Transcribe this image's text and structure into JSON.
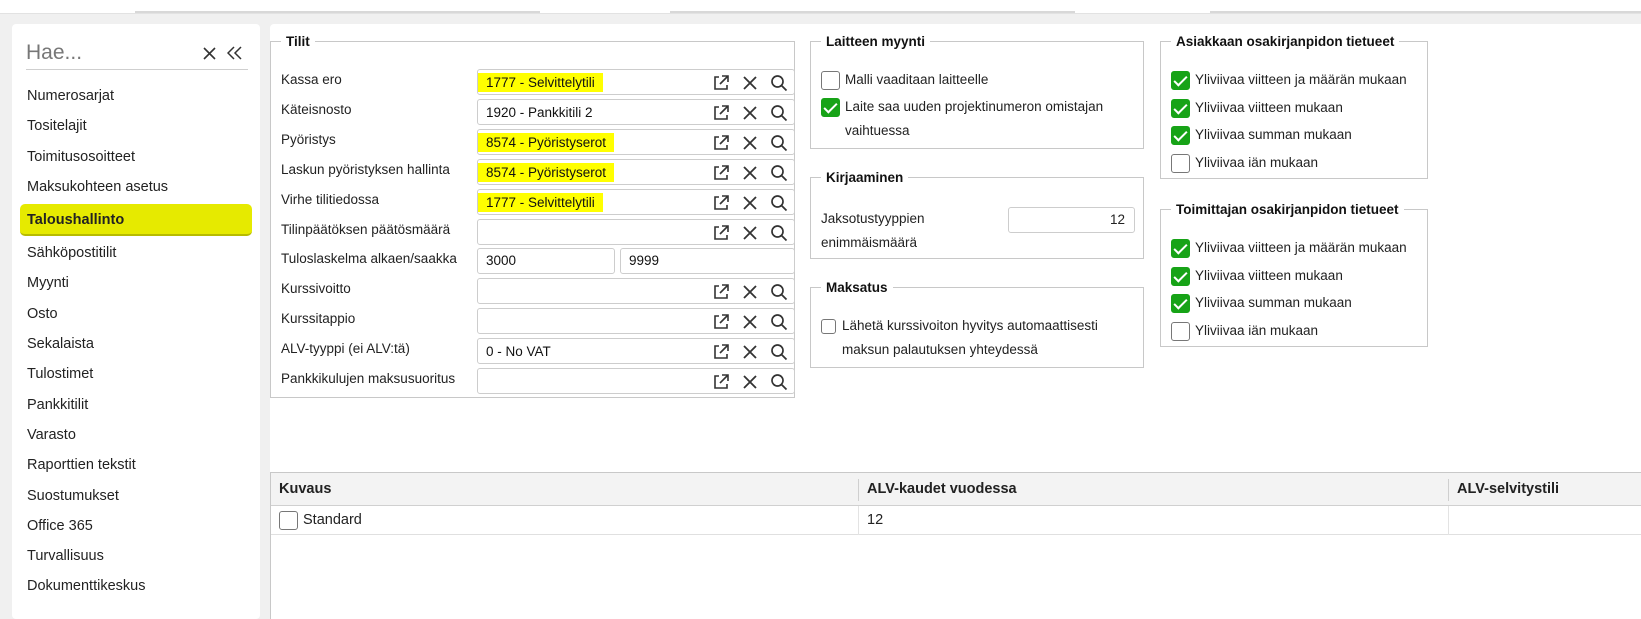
{
  "sidebar": {
    "search_placeholder": "Hae...",
    "items": [
      {
        "label": "Numerosarjat"
      },
      {
        "label": "Tositelajit"
      },
      {
        "label": "Toimitusosoitteet"
      },
      {
        "label": "Maksukohteen asetus"
      },
      {
        "label": "Taloushallinto",
        "active": true
      },
      {
        "label": "Sähköpostitilit"
      },
      {
        "label": "Myynti"
      },
      {
        "label": "Osto"
      },
      {
        "label": "Sekalaista"
      },
      {
        "label": "Tulostimet"
      },
      {
        "label": "Pankkitilit"
      },
      {
        "label": "Varasto"
      },
      {
        "label": "Raporttien tekstit"
      },
      {
        "label": "Suostumukset"
      },
      {
        "label": "Office 365"
      },
      {
        "label": "Turvallisuus"
      },
      {
        "label": "Dokumenttikeskus"
      }
    ]
  },
  "tilit": {
    "title": "Tilit",
    "rows": [
      {
        "label": "Kassa ero",
        "value": "1777 - Selvittelytili",
        "highlighted": true
      },
      {
        "label": "Käteisnosto",
        "value": "1920 - Pankkitili 2",
        "highlighted": false
      },
      {
        "label": "Pyöristys",
        "value": "8574 - Pyöristyserot",
        "highlighted": true
      },
      {
        "label": "Laskun pyöristyksen hallinta",
        "value": "8574 - Pyöristyserot",
        "highlighted": true
      },
      {
        "label": "Virhe tilitiedossa",
        "value": "1777 - Selvittelytili",
        "highlighted": true
      },
      {
        "label": "Tilinpäätöksen päätösmäärä",
        "value": "",
        "highlighted": false
      },
      {
        "label": "Tuloslaskelma alkaen/saakka",
        "from": "3000",
        "to": "9999",
        "range": true
      },
      {
        "label": "Kurssivoitto",
        "value": "",
        "highlighted": false
      },
      {
        "label": "Kurssitappio",
        "value": "",
        "highlighted": false
      },
      {
        "label": "ALV-tyyppi (ei ALV:tä)",
        "value": "0 - No VAT",
        "highlighted": false
      },
      {
        "label": "Pankkikulujen maksusuoritus",
        "value": "",
        "highlighted": false
      }
    ]
  },
  "laitteen_myynti": {
    "title": "Laitteen myynti",
    "opt1": {
      "label": "Malli vaaditaan laitteelle",
      "checked": false
    },
    "opt2": {
      "line1": "Laite saa uuden projektinumeron omistajan",
      "line2": "vaihtuessa",
      "checked": true
    }
  },
  "kirjaaminen": {
    "title": "Kirjaaminen",
    "label1": "Jaksotustyyppien",
    "label2": "enimmäismäärä",
    "value": "12"
  },
  "maksatus": {
    "title": "Maksatus",
    "line1": "Lähetä kurssivoiton hyvitys automaattisesti",
    "line2": "maksun palautuksen yhteydessä",
    "checked": false
  },
  "asiakas": {
    "title": "Asiakkaan osakirjanpidon tietueet",
    "items": [
      {
        "label": "Yliviivaa viitteen ja määrän mukaan",
        "checked": true
      },
      {
        "label": "Yliviivaa viitteen mukaan",
        "checked": true
      },
      {
        "label": "Yliviivaa summan mukaan",
        "checked": true
      },
      {
        "label": "Yliviivaa iän mukaan",
        "checked": false
      }
    ]
  },
  "toimittaja": {
    "title": "Toimittajan osakirjanpidon tietueet",
    "items": [
      {
        "label": "Yliviivaa viitteen ja määrän mukaan",
        "checked": true
      },
      {
        "label": "Yliviivaa viitteen mukaan",
        "checked": true
      },
      {
        "label": "Yliviivaa summan mukaan",
        "checked": true
      },
      {
        "label": "Yliviivaa iän mukaan",
        "checked": false
      }
    ]
  },
  "grid": {
    "headers": [
      "Kuvaus",
      "ALV-kaudet vuodessa",
      "ALV-selvitystili"
    ],
    "rows": [
      {
        "kuvaus": "Standard",
        "kaudet": "12",
        "selvitystili": "",
        "checked": false
      }
    ]
  },
  "colors": {
    "highlight": "#ffff00",
    "active_nav": "#e6ea00",
    "check_green": "#17a317"
  }
}
